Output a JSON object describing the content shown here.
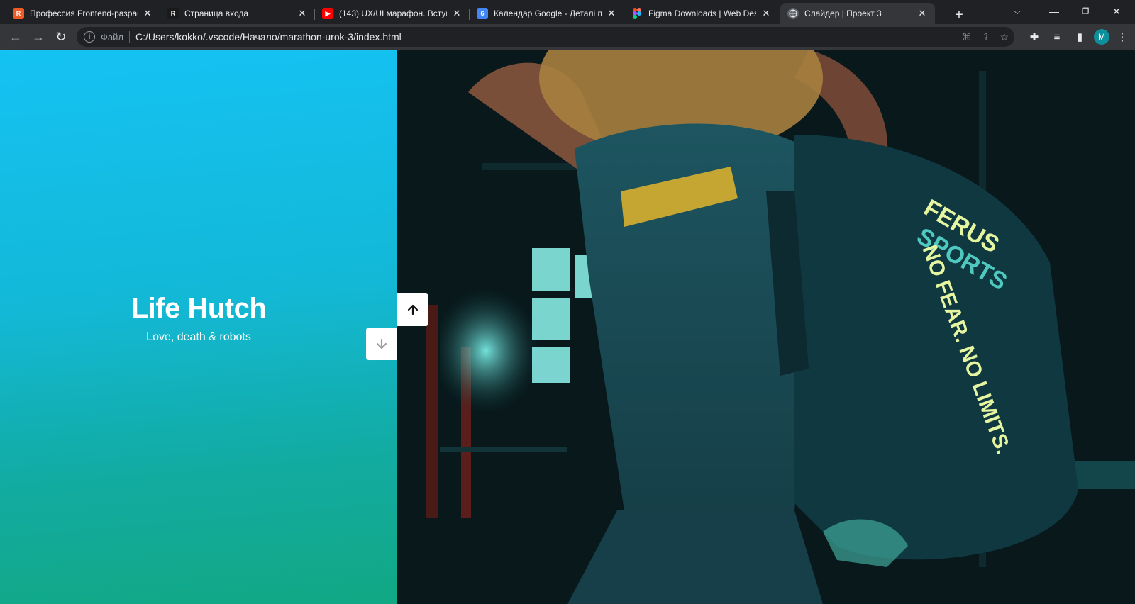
{
  "browser": {
    "tabs": [
      {
        "title": "Профессия Frontend-разраб",
        "favicon_text": "R",
        "favicon_color": "#ef5b25"
      },
      {
        "title": "Страница входа",
        "favicon_text": "R",
        "favicon_color": "#1a1a1a"
      },
      {
        "title": "(143) UX/UI марафон. Вступ",
        "favicon_text": "▶",
        "favicon_color": "#ff0000"
      },
      {
        "title": "Календар Google - Деталі по",
        "favicon_text": "6",
        "favicon_color": "#4285f4"
      },
      {
        "title": "Figma Downloads | Web Desi",
        "favicon_text": "",
        "favicon_color": "#a259ff"
      },
      {
        "title": "Слайдер | Проект 3",
        "favicon_text": "",
        "favicon_color": "#9aa0a6",
        "active": true
      }
    ],
    "address_bar": {
      "scheme_label": "Файл",
      "url": "C:/Users/kokko/.vscode/Начало/marathon-urok-3/index.html"
    },
    "profile_initial": "M",
    "accent_color": "#0e8f9c"
  },
  "slider": {
    "title": "Life Hutch",
    "subtitle": "Love, death & robots",
    "gradient_top": "#14c2f3",
    "gradient_bottom": "#11a884",
    "photo_prints": [
      "FERUS",
      "SPORTS",
      "NO FEAR. NO LIMITS."
    ]
  }
}
